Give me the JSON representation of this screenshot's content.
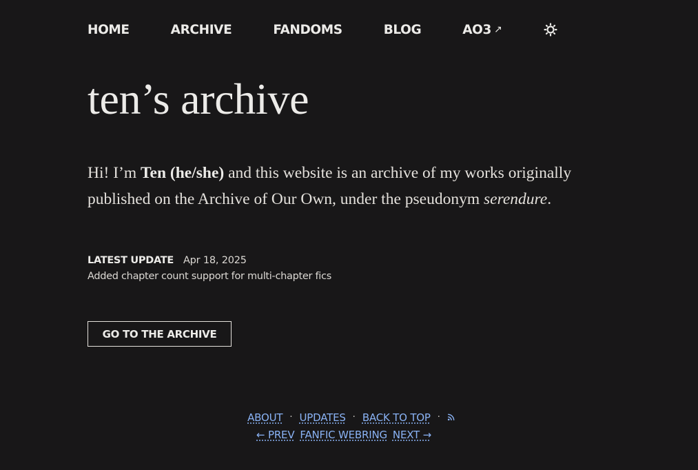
{
  "nav": {
    "items": [
      {
        "label": "HOME"
      },
      {
        "label": "ARCHIVE"
      },
      {
        "label": "FANDOMS"
      },
      {
        "label": "BLOG"
      },
      {
        "label": "AO3",
        "ext": "↗"
      }
    ],
    "theme_icon": "sun-icon"
  },
  "page": {
    "title": "ten’s archive",
    "intro": {
      "p1": "Hi! I’m ",
      "name": "Ten (he/she)",
      "p2": " and this website is an archive of my works originally published on the Archive of Our Own, under the pseudonym ",
      "pseudonym": "serendure",
      "p3": "."
    }
  },
  "update": {
    "label": "LATEST UPDATE",
    "date": "Apr 18, 2025",
    "description": "Added chapter count support for multi-chapter fics"
  },
  "cta": {
    "label": "GO TO THE ARCHIVE"
  },
  "footer": {
    "links": {
      "about": "ABOUT",
      "updates": "UPDATES",
      "back_to_top": "BACK TO TOP"
    },
    "separator": "·",
    "rss_icon": "rss-icon",
    "webring": {
      "prev": "← PREV",
      "name": "FANFIC WEBRING",
      "next": "NEXT →"
    }
  },
  "colors": {
    "background": "#181718",
    "text": "#ecebe8",
    "link": "#8ab3f5"
  }
}
